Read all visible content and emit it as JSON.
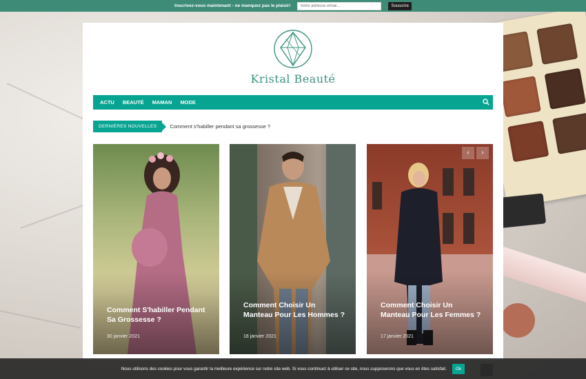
{
  "newsletter": {
    "text": "Inscrivez-vous maintenant - ne manquez pas le plaisir!",
    "placeholder": "Votre adresse email...",
    "button": "Souscrire"
  },
  "brand": {
    "name": "Kristal Beauté",
    "accent": "#07a492",
    "logo_color": "#3e9280"
  },
  "nav": {
    "items": [
      "ACTU",
      "BEAUTÉ",
      "MAMAN",
      "MODE"
    ],
    "search_icon": "search-icon"
  },
  "ticker": {
    "label": "Dernières Nouvelles",
    "headline": "Comment s'habiller pendant sa grossesse ?"
  },
  "slider": {
    "prev": "‹",
    "next": "›",
    "cards": [
      {
        "title": "Comment S'habiller Pendant Sa Grossesse ?",
        "date": "30 janvier 2021"
      },
      {
        "title": "Comment Choisir Un Manteau Pour Les Hommes ?",
        "date": "18 janvier 2021"
      },
      {
        "title": "Comment Choisir Un Manteau Pour Les Femmes ?",
        "date": "17 janvier 2021"
      }
    ]
  },
  "cookie": {
    "text": "Nous utilisons des cookies pour vous garantir la meilleure expérience sur notre site web. Si vous continuez à utiliser ce site, nous supposerons que vous en êtes satisfait.",
    "button": "Ok"
  }
}
